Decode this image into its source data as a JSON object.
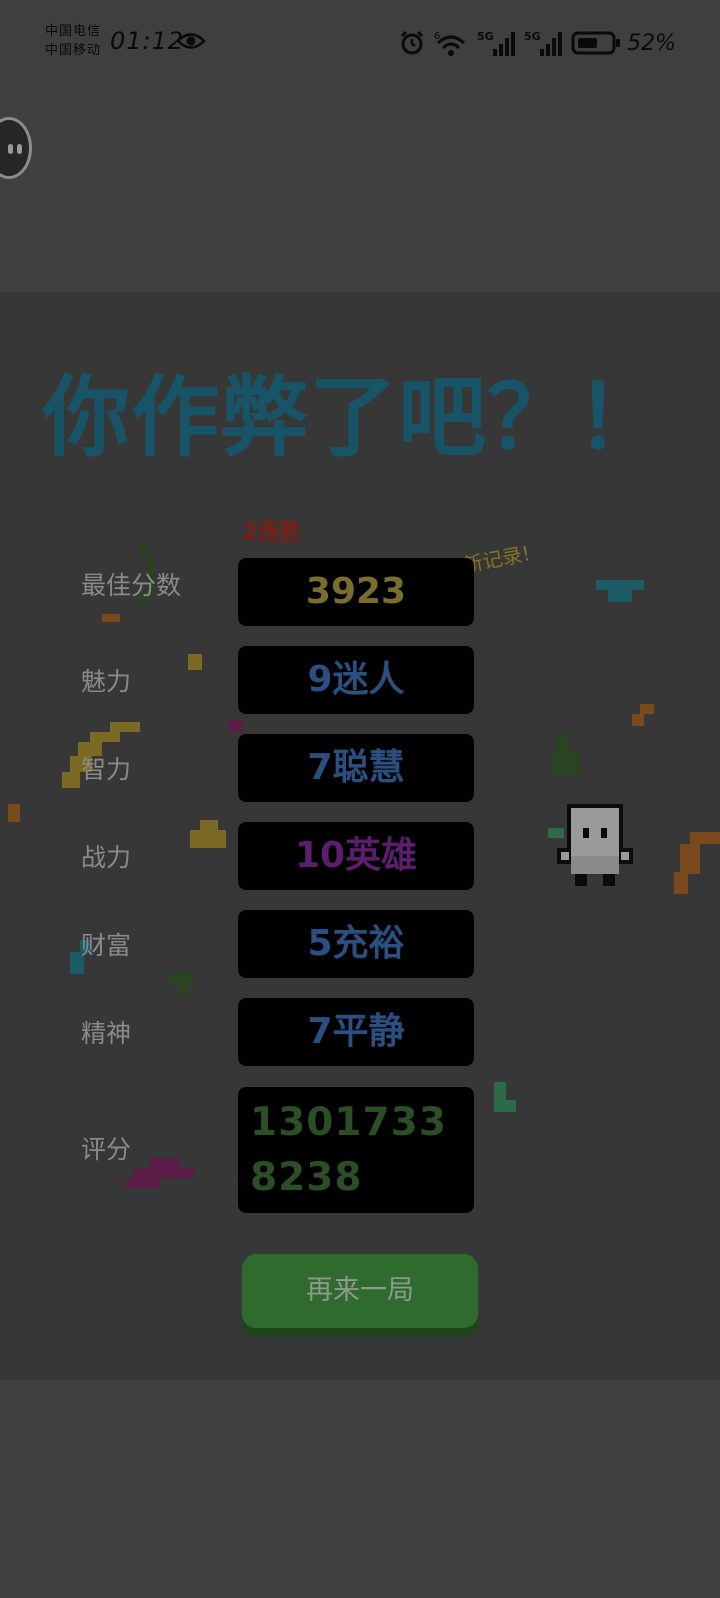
{
  "status_bar": {
    "carrier_1": "中国电信",
    "carrier_2": "中国移动",
    "time": "01:12",
    "battery": "52%",
    "icons": [
      "eye-icon",
      "alarm-icon",
      "wifi-icon",
      "signal-5g-icon",
      "signal-5g-icon",
      "battery-icon"
    ]
  },
  "game": {
    "headline": "你作弊了吧？！",
    "streak": "2连胜",
    "new_record": "新记录!",
    "stats": [
      {
        "label": "最佳分数",
        "value": "3923",
        "color": "#7a6e2d"
      },
      {
        "label": "魅力",
        "value": "9迷人",
        "color": "#2a4f80"
      },
      {
        "label": "智力",
        "value": "7聪慧",
        "color": "#2a4f80"
      },
      {
        "label": "战力",
        "value": "10英雄",
        "color": "#5d1d6e"
      },
      {
        "label": "财富",
        "value": "5充裕",
        "color": "#2a4f80"
      },
      {
        "label": "精神",
        "value": "7平静",
        "color": "#2a4f80"
      }
    ],
    "score": {
      "label": "评分",
      "value": "13017338238"
    },
    "replay_button": "再来一局"
  },
  "colors": {
    "background": "#3f3f3f",
    "panel": "#373737",
    "headline": "#175468",
    "streak": "#7e1d14",
    "button": "#2f6a2e"
  }
}
